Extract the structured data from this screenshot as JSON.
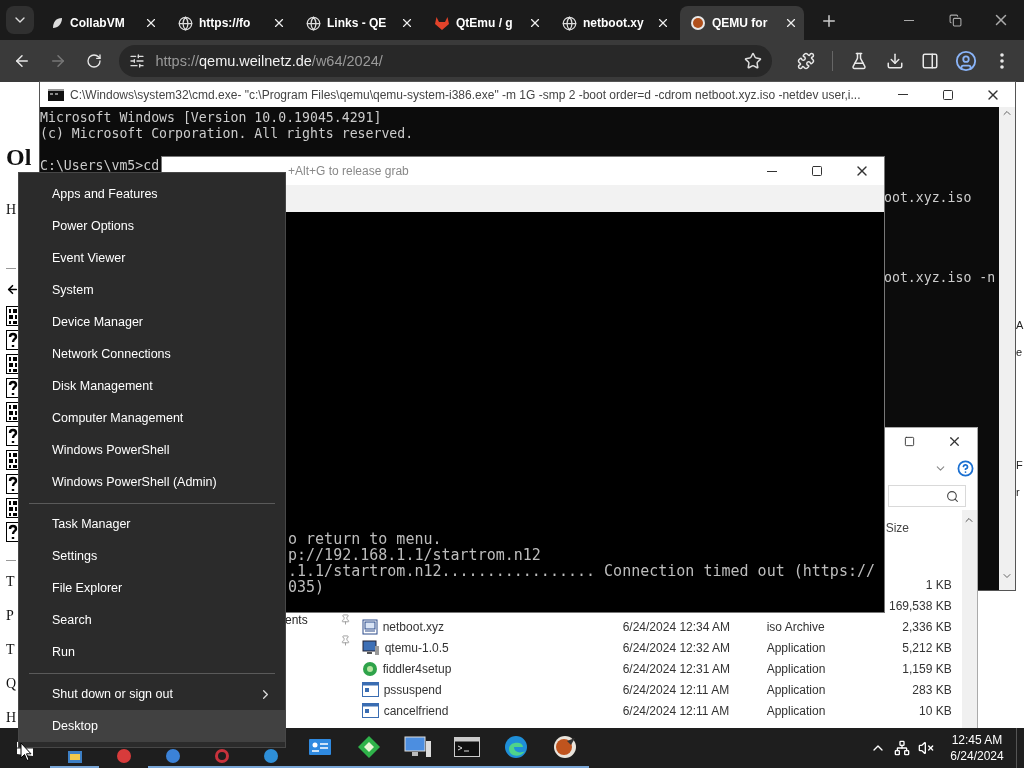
{
  "browser": {
    "tabs": [
      {
        "title": "CollabVM",
        "kind": "leaf",
        "selected": false
      },
      {
        "title": "https://fo",
        "kind": "globe",
        "selected": false
      },
      {
        "title": "Links - QE",
        "kind": "globe",
        "selected": false
      },
      {
        "title": "QtEmu / g",
        "kind": "fox",
        "selected": false
      },
      {
        "title": "netboot.xy",
        "kind": "globe",
        "selected": false
      },
      {
        "title": "QEMU for",
        "kind": "qemu",
        "selected": true
      }
    ],
    "nav_buttons": [
      {
        "kind": "back",
        "disabled": false
      },
      {
        "kind": "forward",
        "disabled": true
      },
      {
        "kind": "reload",
        "disabled": false
      }
    ],
    "address": {
      "scheme": "https://",
      "host": "qemu.weilnetz.de",
      "path": "/w64/2024/"
    },
    "toolbar_icons": [
      {
        "kind": "extensions"
      },
      {
        "kind": "labs"
      },
      {
        "kind": "download"
      },
      {
        "kind": "sidebar"
      },
      {
        "kind": "profile"
      },
      {
        "kind": "menu"
      }
    ]
  },
  "page": {
    "heading": "Ol",
    "intro": "H",
    "file_icons": [
      {
        "kind": "binary"
      },
      {
        "kind": "unknown"
      },
      {
        "kind": "binary"
      },
      {
        "kind": "unknown"
      },
      {
        "kind": "binary"
      },
      {
        "kind": "unknown"
      },
      {
        "kind": "binary"
      },
      {
        "kind": "unknown"
      },
      {
        "kind": "binary"
      },
      {
        "kind": "unknown"
      }
    ],
    "lines": [
      "T",
      "P",
      "T",
      "Q",
      "H"
    ],
    "right_fragments": [
      "A",
      "e",
      "F",
      "r"
    ]
  },
  "cmd": {
    "title": "C:\\Windows\\system32\\cmd.exe- \"c:\\Program Files\\qemu\\qemu-system-i386.exe\"  -m 1G -smp 2 -boot order=d -cdrom netboot.xyz.iso -netdev user,i...",
    "lines": [
      "Microsoft Windows [Version 10.0.19045.4291]",
      "(c) Microsoft Corporation. All rights reserved.",
      "C:\\Users\\vm5>cd"
    ],
    "fragments": [
      "oot.xyz.iso",
      "oot.xyz.iso -n"
    ]
  },
  "explorer": {
    "size_header": "Size",
    "nav_item": "ents",
    "rows": [
      {
        "size": "1 KB"
      },
      {
        "size": "169,538 KB"
      },
      {
        "kind": "iso",
        "name": "netboot.xyz",
        "date": "6/24/2024 12:34 AM",
        "type": "iso Archive",
        "size": "2,336 KB"
      },
      {
        "kind": "computer",
        "name": "qtemu-1.0.5",
        "date": "6/24/2024 12:32 AM",
        "type": "Application",
        "size": "5,212 KB"
      },
      {
        "kind": "setup",
        "name": "fiddler4setup",
        "date": "6/24/2024 12:31 AM",
        "type": "Application",
        "size": "1,159 KB"
      },
      {
        "kind": "app",
        "name": "pssuspend",
        "date": "6/24/2024 12:11 AM",
        "type": "Application",
        "size": "283 KB"
      },
      {
        "kind": "app",
        "name": "cancelfriend",
        "date": "6/24/2024 12:11 AM",
        "type": "Application",
        "size": "10 KB"
      }
    ]
  },
  "qemu": {
    "title": "+Alt+G to release grab",
    "screen_lines": [
      "o return to menu.",
      "p://192.168.1.1/startrom.n12",
      ".1.1/startrom.n12................. Connection timed out (https://",
      "035)"
    ]
  },
  "start_menu": {
    "sections": [
      [
        {
          "label": "Apps and Features",
          "submenu": false,
          "selected": false
        },
        {
          "label": "Power Options",
          "submenu": false,
          "selected": false
        },
        {
          "label": "Event Viewer",
          "submenu": false,
          "selected": false
        },
        {
          "label": "System",
          "submenu": false,
          "selected": false
        },
        {
          "label": "Device Manager",
          "submenu": false,
          "selected": false
        },
        {
          "label": "Network Connections",
          "submenu": false,
          "selected": false
        },
        {
          "label": "Disk Management",
          "submenu": false,
          "selected": false
        },
        {
          "label": "Computer Management",
          "submenu": false,
          "selected": false
        },
        {
          "label": "Windows PowerShell",
          "submenu": false,
          "selected": false
        },
        {
          "label": "Windows PowerShell (Admin)",
          "submenu": false,
          "selected": false
        }
      ],
      [
        {
          "label": "Task Manager",
          "submenu": false,
          "selected": false
        },
        {
          "label": "Settings",
          "submenu": false,
          "selected": false
        },
        {
          "label": "File Explorer",
          "submenu": false,
          "selected": false
        },
        {
          "label": "Search",
          "submenu": false,
          "selected": false
        },
        {
          "label": "Run",
          "submenu": false,
          "selected": false
        }
      ],
      [
        {
          "label": "Shut down or sign out",
          "submenu": true,
          "selected": false
        },
        {
          "label": "Desktop",
          "submenu": false,
          "selected": true
        }
      ]
    ]
  },
  "taskbar": {
    "apps": [
      {
        "kind": "tile",
        "running": true
      },
      {
        "kind": "dot",
        "color": "#d83b3b",
        "running": false
      },
      {
        "kind": "dot",
        "color": "#3b82d8",
        "running": true
      },
      {
        "kind": "ring",
        "color": "#c8323c",
        "running": true
      },
      {
        "kind": "dot",
        "color": "#2e8fd8",
        "running": true
      },
      {
        "kind": "card",
        "running": true
      },
      {
        "kind": "diamond",
        "running": true
      },
      {
        "kind": "computer",
        "running": true
      },
      {
        "kind": "terminal",
        "running": true
      },
      {
        "kind": "edge",
        "running": true
      },
      {
        "kind": "qemu",
        "running": true
      }
    ],
    "time": "12:45 AM",
    "date": "6/24/2024"
  }
}
